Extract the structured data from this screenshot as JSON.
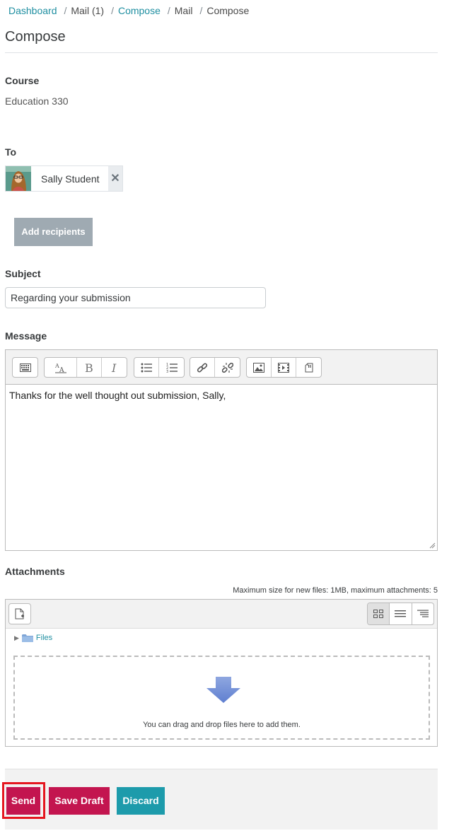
{
  "breadcrumb": {
    "items": [
      "Dashboard",
      "Mail (1)",
      "Compose",
      "Mail",
      "Compose"
    ],
    "separator": "/"
  },
  "page": {
    "title": "Compose"
  },
  "course": {
    "label": "Course",
    "value": "Education 330"
  },
  "recipients": {
    "label": "To",
    "items": [
      {
        "name": "Sally Student",
        "remove_symbol": "✕"
      }
    ],
    "add_button": "Add recipients"
  },
  "subject": {
    "label": "Subject",
    "value": "Regarding your submission"
  },
  "message": {
    "label": "Message",
    "body": "Thanks for the well thought out submission, Sally,",
    "toolbar_icons": [
      "show-more-buttons-icon",
      "font-style-icon",
      "bold-icon",
      "italic-icon",
      "unordered-list-icon",
      "ordered-list-icon",
      "link-icon",
      "unlink-icon",
      "insert-image-icon",
      "insert-media-icon",
      "manage-files-icon"
    ]
  },
  "attachments": {
    "label": "Attachments",
    "limits_note": "Maximum size for new files: 1MB, maximum attachments: 5",
    "folder": "Files",
    "drop_text": "You can drag and drop files here to add them."
  },
  "actions": {
    "send": "Send",
    "save_draft": "Save Draft",
    "discard": "Discard"
  },
  "colors": {
    "link": "#1f8fa1",
    "primary_button": "#c3154f",
    "discard_button": "#1d9bab",
    "add_button": "#9faab2",
    "highlight_outline": "#e5161f"
  }
}
